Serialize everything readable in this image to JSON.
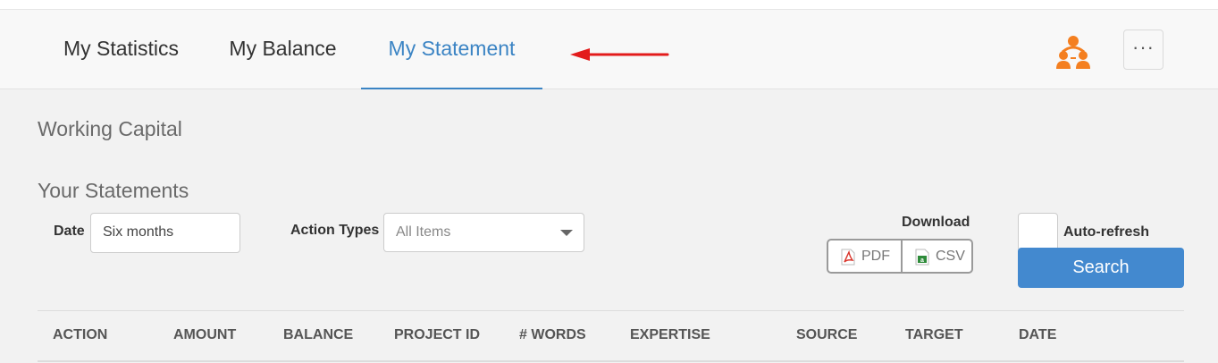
{
  "nav": {
    "tabs": [
      {
        "label": "My Statistics",
        "active": false
      },
      {
        "label": "My Balance",
        "active": false
      },
      {
        "label": "My Statement",
        "active": true
      }
    ],
    "more_label": "···"
  },
  "colors": {
    "accent": "#3b84c4",
    "button": "#4389cf",
    "icon": "#f47f20",
    "annotation_arrow": "#e31b1b"
  },
  "icons": [
    "red-arrow-icon",
    "team-icon",
    "more-icon",
    "pdf-icon",
    "csv-icon",
    "caret-down-icon"
  ],
  "sections": {
    "working_capital": "Working Capital",
    "your_statements": "Your Statements"
  },
  "filters": {
    "date_label": "Date",
    "date_value": "Six months",
    "action_types_label": "Action Types",
    "action_types_value": "All Items"
  },
  "download": {
    "label": "Download",
    "pdf": "PDF",
    "csv": "CSV"
  },
  "auto_refresh": {
    "label": "Auto-refresh",
    "checked": false
  },
  "search_label": "Search",
  "table": {
    "headers": [
      "ACTION",
      "AMOUNT",
      "BALANCE",
      "PROJECT ID",
      "# WORDS",
      "EXPERTISE",
      "SOURCE",
      "TARGET",
      "DATE"
    ]
  }
}
